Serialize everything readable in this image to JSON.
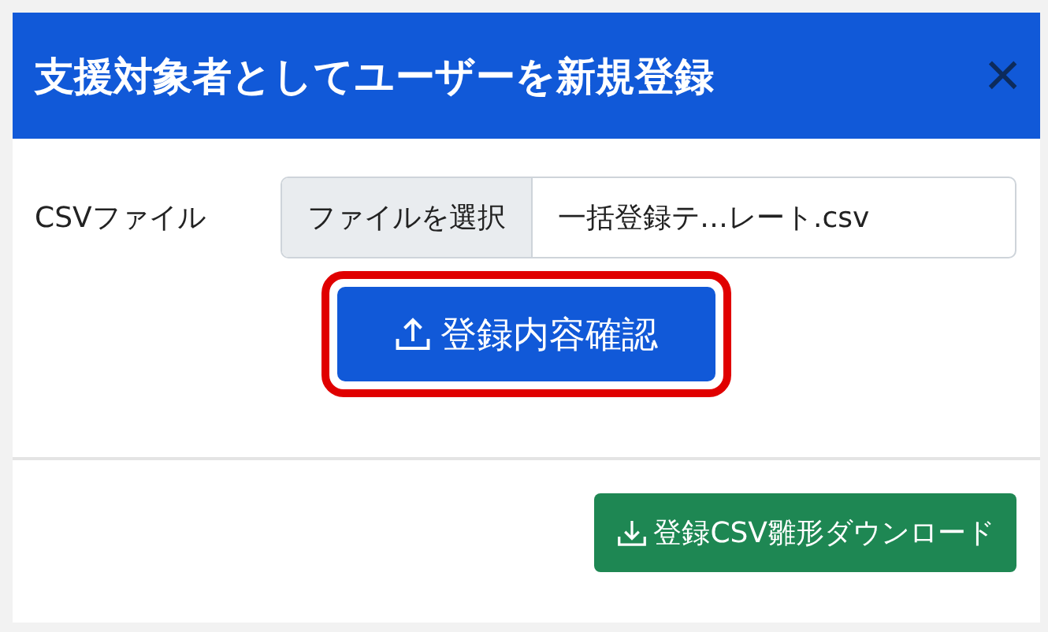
{
  "dialog": {
    "title": "支援対象者としてユーザーを新規登録",
    "close": "×"
  },
  "csv_field": {
    "label": "CSVファイル",
    "choose_button": "ファイルを選択",
    "file_name": "一括登録テ…レート.csv"
  },
  "confirm_button": {
    "label": "登録内容確認",
    "highlighted": true
  },
  "download_button": {
    "label": "登録CSV雛形ダウンロード"
  }
}
